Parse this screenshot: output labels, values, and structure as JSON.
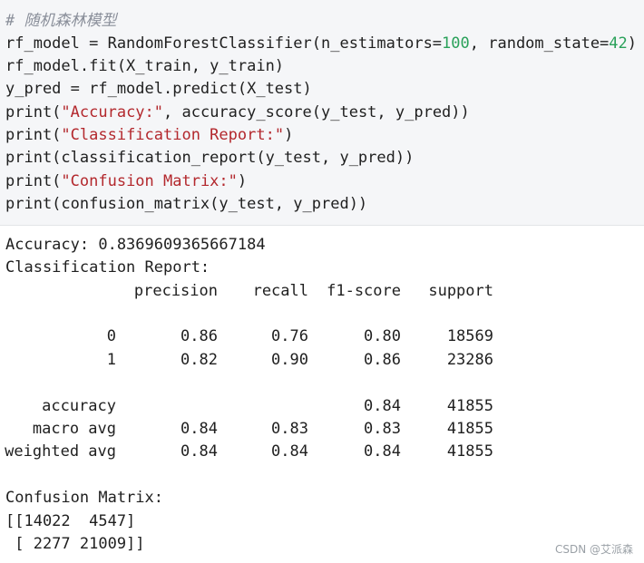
{
  "code": {
    "comment": "# 随机森林模型",
    "line1": {
      "a": "rf_model = RandomForestClassifier(n_estimators=",
      "n1": "100",
      "b": ", random_state=",
      "n2": "42",
      "c": ")"
    },
    "line2": "rf_model.fit(X_train, y_train)",
    "line3": "y_pred = rf_model.predict(X_test)",
    "line4": {
      "a": "print(",
      "s": "\"Accuracy:\"",
      "b": ", accuracy_score(y_test, y_pred))"
    },
    "line5": {
      "a": "print(",
      "s": "\"Classification Report:\"",
      "b": ")"
    },
    "line6": "print(classification_report(y_test, y_pred))",
    "line7": {
      "a": "print(",
      "s": "\"Confusion Matrix:\"",
      "b": ")"
    },
    "line8": "print(confusion_matrix(y_test, y_pred))"
  },
  "output": {
    "accuracy_line": "Accuracy: 0.8369609365667184",
    "report_title": "Classification Report:",
    "report": {
      "headers": [
        "precision",
        "recall",
        "f1-score",
        "support"
      ],
      "rows": [
        {
          "label": "0",
          "values": [
            "0.86",
            "0.76",
            "0.80",
            "18569"
          ]
        },
        {
          "label": "1",
          "values": [
            "0.82",
            "0.90",
            "0.86",
            "23286"
          ]
        },
        {
          "label": "accuracy",
          "values": [
            "",
            "",
            "0.84",
            "41855"
          ]
        },
        {
          "label": "macro avg",
          "values": [
            "0.84",
            "0.83",
            "0.83",
            "41855"
          ]
        },
        {
          "label": "weighted avg",
          "values": [
            "0.84",
            "0.84",
            "0.84",
            "41855"
          ]
        }
      ]
    },
    "cm_title": "Confusion Matrix:",
    "cm_line1": "[[14022  4547]",
    "cm_line2": " [ 2277 21009]]"
  },
  "watermark": "CSDN @艾派森"
}
